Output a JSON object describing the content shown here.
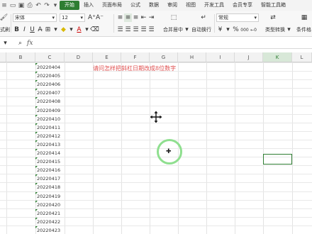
{
  "menubar": {
    "tabs": [
      "开始",
      "插入",
      "页面布局",
      "公式",
      "数据",
      "审阅",
      "视图",
      "开发工具",
      "会员专享",
      "智能工具箱"
    ],
    "active_tab": "开始"
  },
  "ribbon": {
    "format_painter_label": "式刷",
    "font_name": "宋体",
    "font_size": "12",
    "merge_label": "合并居中",
    "wrap_label": "自动换行",
    "number_format": "常规",
    "type_convert_label": "类型转换",
    "conditional_label": "条件格",
    "bold": "B",
    "italic": "I",
    "underline": "U",
    "currency": "¥",
    "percent": "%",
    "thousands": "000"
  },
  "formula_bar": {
    "fx_label": "fx",
    "value": ""
  },
  "grid": {
    "columns": [
      "B",
      "C",
      "D",
      "E",
      "F",
      "G",
      "H",
      "I",
      "J",
      "K",
      "L"
    ],
    "selected_column": "K",
    "column_c_values": [
      "20220404",
      "20220405",
      "20220406",
      "20220407",
      "20220408",
      "20220409",
      "20220410",
      "20220411",
      "20220412",
      "20220413",
      "20220414",
      "20220415",
      "20220416",
      "20220417",
      "20220418",
      "20220419",
      "20220420",
      "20220421",
      "20220422",
      "20220423"
    ],
    "note_text": "请问怎样把斜杠日期改成8位数字"
  },
  "colors": {
    "accent": "#2e7d32",
    "note": "#e05050",
    "click_ring": "#8fdf8f"
  }
}
